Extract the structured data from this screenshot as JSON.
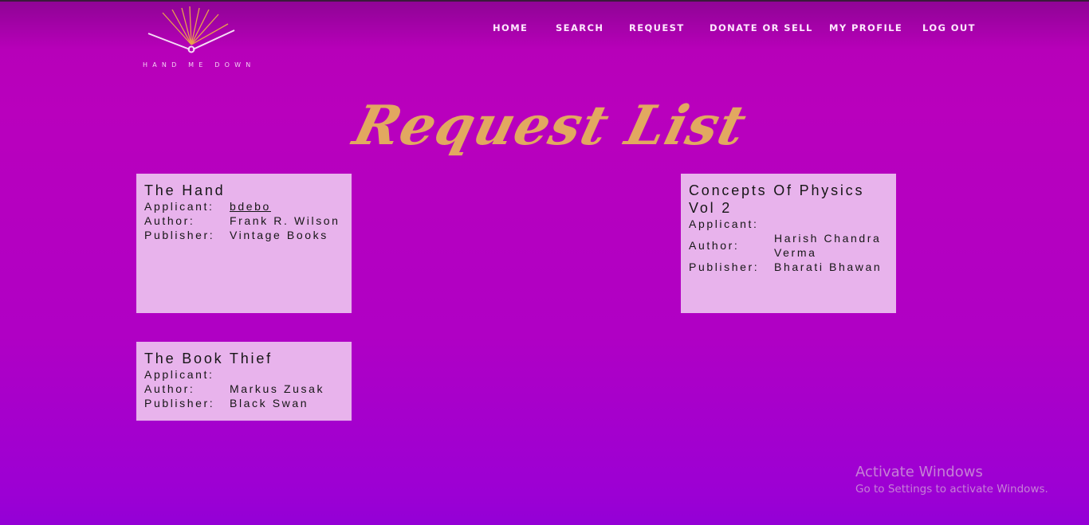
{
  "brand": {
    "logo_text": "HAND ME DOWN"
  },
  "nav": {
    "items": [
      {
        "label": "HOME"
      },
      {
        "label": "SEARCH"
      },
      {
        "label": "REQUEST"
      },
      {
        "label": "DONATE OR SELL"
      },
      {
        "label": "MY PROFILE"
      },
      {
        "label": "LOG OUT"
      }
    ]
  },
  "page_title": "Request List",
  "labels": {
    "applicant": "Applicant:",
    "author": "Author:",
    "publisher": "Publisher:"
  },
  "requests": [
    {
      "title": "The Hand",
      "applicant": "bdebo",
      "author": "Frank R. Wilson",
      "publisher": "Vintage Books"
    },
    {
      "title": "Concepts Of Physics Vol 2",
      "applicant": "",
      "author": "Harish Chandra Verma",
      "publisher": "Bharati Bhawan"
    },
    {
      "title": "The Book Thief",
      "applicant": "",
      "author": "Markus Zusak",
      "publisher": "Black Swan"
    }
  ],
  "watermark": {
    "line1": "Activate Windows",
    "line2": "Go to Settings to activate Windows."
  },
  "colors": {
    "background": "#b900bd",
    "card": "#e8b3ec",
    "title": "#e2a860",
    "nav_text": "#ffe9ff"
  }
}
